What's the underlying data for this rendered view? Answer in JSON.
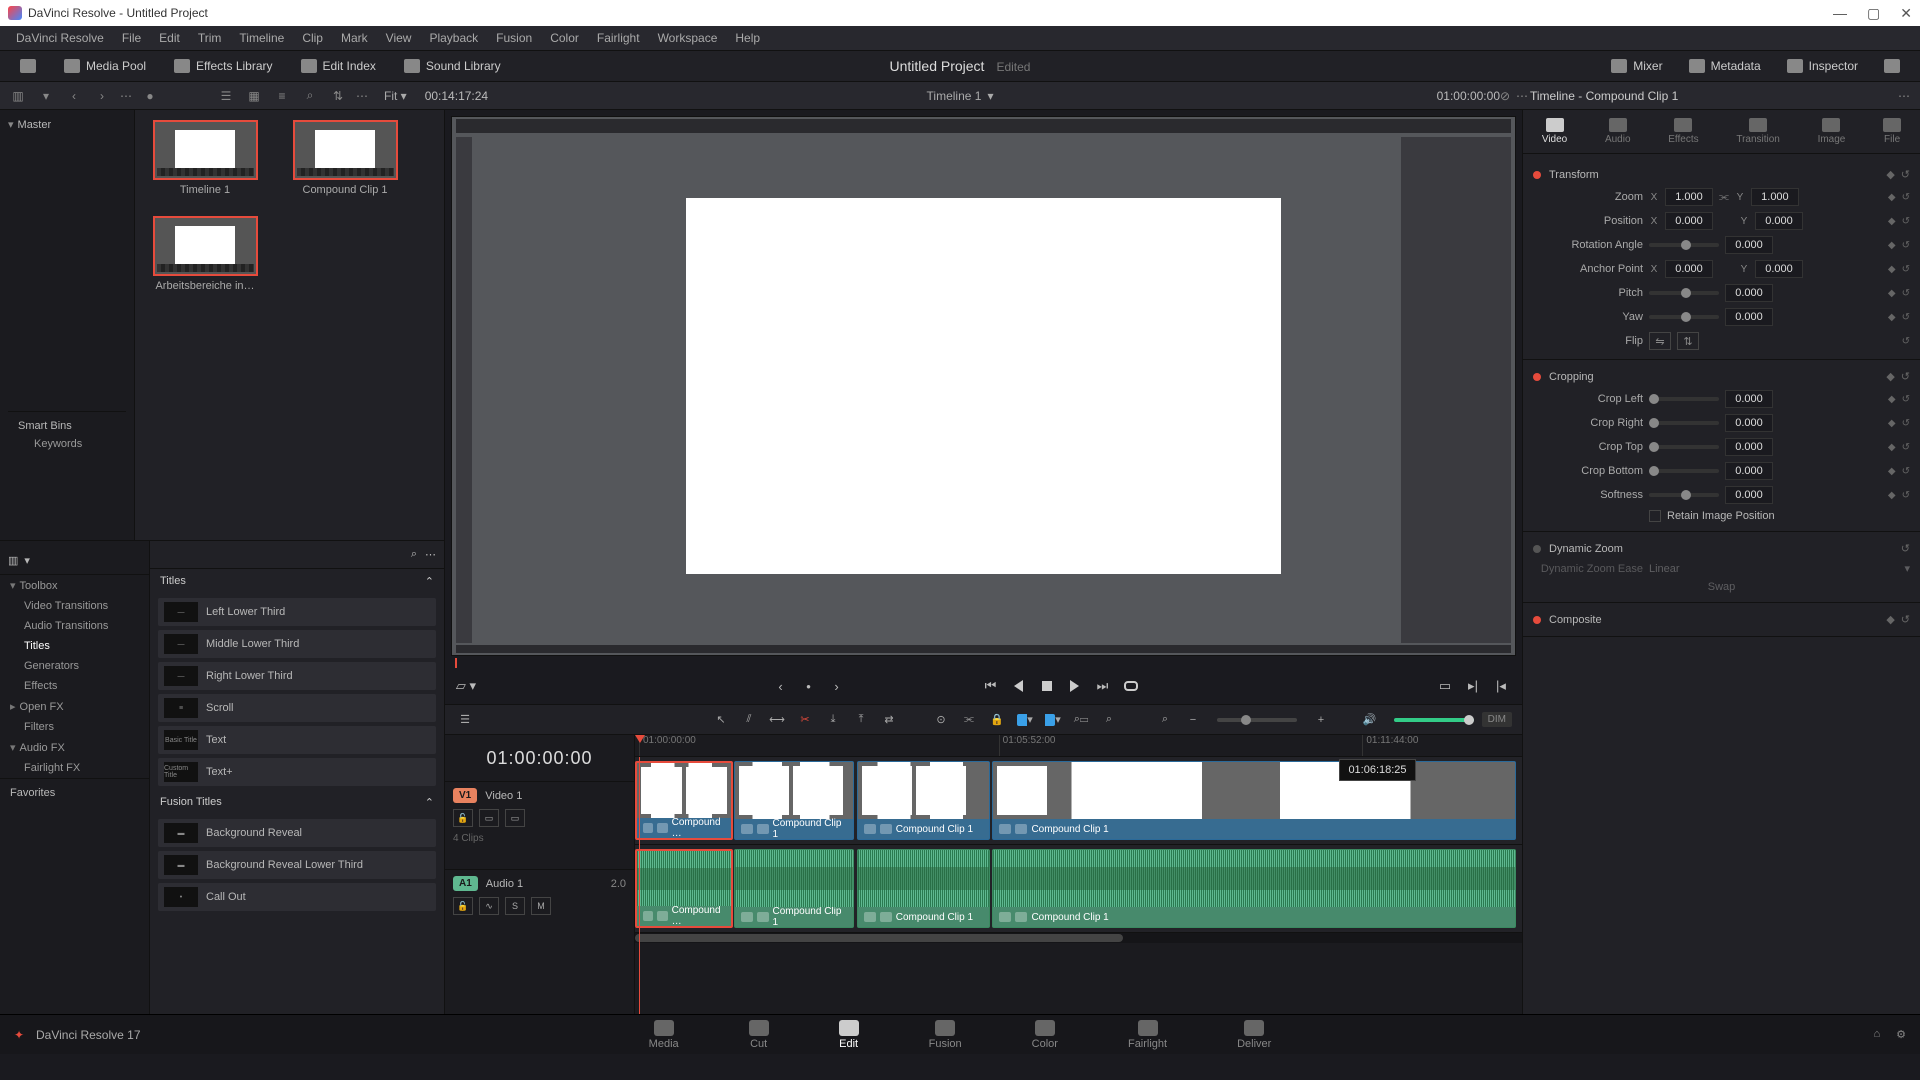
{
  "window_title": "DaVinci Resolve - Untitled Project",
  "menu": [
    "DaVinci Resolve",
    "File",
    "Edit",
    "Trim",
    "Timeline",
    "Clip",
    "Mark",
    "View",
    "Playback",
    "Fusion",
    "Color",
    "Fairlight",
    "Workspace",
    "Help"
  ],
  "toolbar": {
    "media_pool": "Media Pool",
    "effects_library": "Effects Library",
    "edit_index": "Edit Index",
    "sound_library": "Sound Library",
    "mixer": "Mixer",
    "metadata": "Metadata",
    "inspector": "Inspector"
  },
  "project": {
    "title": "Untitled Project",
    "edited": "Edited"
  },
  "viewer": {
    "fit": "Fit",
    "tc_left": "00:14:17:24",
    "timeline_name": "Timeline 1",
    "tc_right": "01:00:00:00"
  },
  "inspector_title": "Timeline - Compound Clip 1",
  "pool": {
    "master": "Master",
    "clips": [
      {
        "name": "Timeline 1",
        "selected": true
      },
      {
        "name": "Compound Clip 1",
        "selected": true
      },
      {
        "name": "Arbeitsbereiche in…",
        "selected": true
      }
    ],
    "smart_bins": "Smart Bins",
    "keywords": "Keywords"
  },
  "effects_panel": {
    "toolbox": "Toolbox",
    "items": [
      "Video Transitions",
      "Audio Transitions",
      "Titles",
      "Generators",
      "Effects"
    ],
    "openfx": "Open FX",
    "filters": "Filters",
    "audiofx": "Audio FX",
    "fairlightfx": "Fairlight FX",
    "favorites": "Favorites"
  },
  "titles_panel": {
    "header": "Titles",
    "list": [
      "Left Lower Third",
      "Middle Lower Third",
      "Right Lower Third",
      "Scroll",
      "Text",
      "Text+"
    ],
    "fusion_header": "Fusion Titles",
    "fusion_list": [
      "Background Reveal",
      "Background Reveal Lower Third",
      "Call Out"
    ]
  },
  "inspector_tabs": [
    "Video",
    "Audio",
    "Effects",
    "Transition",
    "Image",
    "File"
  ],
  "transform": {
    "label": "Transform",
    "zoom": "Zoom",
    "zoom_x": "1.000",
    "zoom_y": "1.000",
    "position": "Position",
    "pos_x": "0.000",
    "pos_y": "0.000",
    "rotation": "Rotation Angle",
    "rot_v": "0.000",
    "anchor": "Anchor Point",
    "anc_x": "0.000",
    "anc_y": "0.000",
    "pitch": "Pitch",
    "pitch_v": "0.000",
    "yaw": "Yaw",
    "yaw_v": "0.000",
    "flip": "Flip"
  },
  "cropping": {
    "label": "Cropping",
    "left": "Crop Left",
    "left_v": "0.000",
    "right": "Crop Right",
    "right_v": "0.000",
    "top": "Crop Top",
    "top_v": "0.000",
    "bottom": "Crop Bottom",
    "bottom_v": "0.000",
    "soft": "Softness",
    "soft_v": "0.000",
    "retain": "Retain Image Position"
  },
  "dynamic_zoom": {
    "label": "Dynamic Zoom",
    "ease": "Dynamic Zoom Ease",
    "ease_v": "Linear",
    "swap": "Swap"
  },
  "composite": {
    "label": "Composite"
  },
  "axis": {
    "x": "X",
    "y": "Y"
  },
  "timeline": {
    "tc": "01:00:00:00",
    "ticks": [
      "01:00:00:00",
      "01:05:52:00",
      "01:11:44:00"
    ],
    "hover_tc": "01:06:18:25",
    "v1": {
      "badge": "V1",
      "name": "Video 1",
      "sub": "4 Clips"
    },
    "a1": {
      "badge": "A1",
      "name": "Audio 1",
      "ch": "2.0",
      "s": "S",
      "m": "M"
    },
    "clip1": "Compound …",
    "clip2": "Compound Clip 1",
    "clip3": "Compound Clip 1",
    "clip4": "Compound Clip 1"
  },
  "volume_dim": "DIM",
  "pages": [
    "Media",
    "Cut",
    "Edit",
    "Fusion",
    "Color",
    "Fairlight",
    "Deliver"
  ],
  "app_version": "DaVinci Resolve 17"
}
